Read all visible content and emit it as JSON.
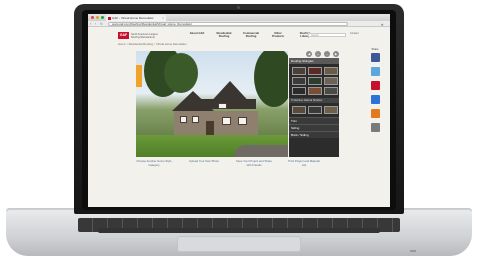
{
  "browser": {
    "tab_title": "GAF - Virtual Home Remodeler",
    "tab_close": "×",
    "url": "www.gaf.com/Roofing/Residential/Virtual_Home_Remodeler",
    "nav_back": "‹",
    "nav_forward": "›",
    "nav_reload": "↻",
    "bookmark_icon": "★"
  },
  "site": {
    "logo_text": "GAF",
    "tagline": "North America's Largest Roofing Manufacturer",
    "nav": [
      "About GAF",
      "Residential Roofing",
      "Commercial Roofing",
      "Other Products",
      "Roofing Library"
    ],
    "search_placeholder": "Search",
    "right_link": "Contact",
    "breadcrumb": "Home > Residential Roofing > Virtual Home Remodeler"
  },
  "visualizer": {
    "controls": [
      "◀",
      "+",
      "–",
      "▶"
    ],
    "panel_title": "Roofing Shingles",
    "swatch_colors": [
      "#4a4038",
      "#5b2a22",
      "#6b5a48",
      "#3a3a3a",
      "#2f3e2a",
      "#6e6156",
      "#2b2b2b",
      "#7a4d34",
      "#4c4a45"
    ],
    "sub_heading": "Timberline Natural Shadow",
    "sub_swatch_colors": [
      "#5a4a3c",
      "#3c3a38",
      "#6f5f4c"
    ],
    "button_1": "Trim",
    "button_2": "Siding",
    "button_3": "Brick / Siding"
  },
  "captions": [
    "Choose Another Home Style Category",
    "Upload Your Own Photo",
    "Save Your Project and Share with Friends",
    "Print Project and Material List"
  ],
  "sidebar": {
    "label": "Share",
    "icon_colors": [
      "#3b5998",
      "#5aa7e0",
      "#c8102e",
      "#2d72d9",
      "#e37a1d",
      "#7a7a7a"
    ]
  }
}
